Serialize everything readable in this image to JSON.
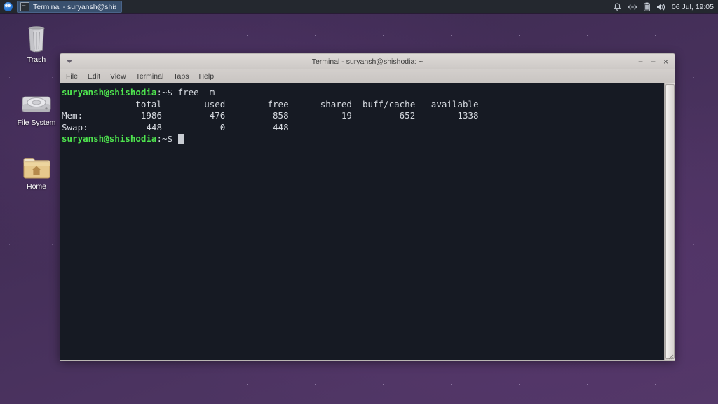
{
  "panel": {
    "app_menu_icon": "xfce-mouse-icon",
    "tasks": [
      {
        "icon": "terminal-icon",
        "label": "Terminal - suryansh@shisho..."
      }
    ],
    "tray": [
      {
        "name": "notification-bell-icon",
        "glyph": "bell"
      },
      {
        "name": "network-icon",
        "glyph": "network"
      },
      {
        "name": "battery-icon",
        "glyph": "battery"
      },
      {
        "name": "volume-icon",
        "glyph": "volume"
      }
    ],
    "clock": "06 Jul, 19:05"
  },
  "desktop": {
    "icons": [
      {
        "name": "trash",
        "label": "Trash"
      },
      {
        "name": "file-system",
        "label": "File System"
      },
      {
        "name": "home",
        "label": "Home"
      }
    ]
  },
  "terminal": {
    "title": "Terminal - suryansh@shishodia: ~",
    "window_controls": {
      "minimize": "−",
      "maximize": "+",
      "close": "×"
    },
    "menu": [
      "File",
      "Edit",
      "View",
      "Terminal",
      "Tabs",
      "Help"
    ],
    "prompt": "suryansh@shishodia",
    "prompt_suffix": ":~$",
    "command": " free -m",
    "output": {
      "headers": [
        "",
        "total",
        "used",
        "free",
        "shared",
        "buff/cache",
        "available"
      ],
      "rows": [
        [
          "Mem:",
          "1986",
          "476",
          "858",
          "19",
          "652",
          "1338"
        ],
        [
          "Swap:",
          "448",
          "0",
          "448",
          "",
          "",
          ""
        ]
      ],
      "raw": "              total        used        free      shared  buff/cache   available\nMem:           1986         476         858          19         652        1338\nSwap:           448           0         448"
    }
  },
  "colors": {
    "panel_bg": "#24282f",
    "task_active": "#39506e",
    "terminal_bg": "#161a23",
    "prompt_green": "#4ee44e",
    "terminal_fg": "#d6dae0",
    "titlebar": "#d6d2cf",
    "wallpaper": "#4b3360"
  }
}
